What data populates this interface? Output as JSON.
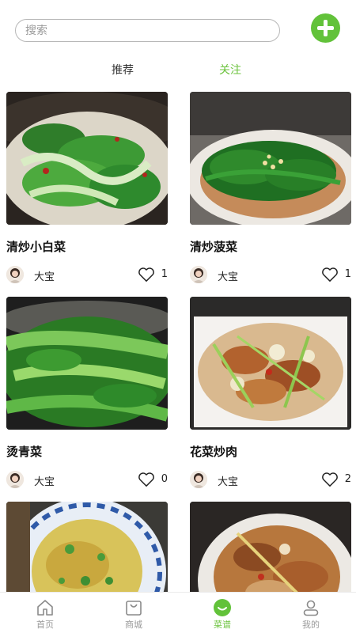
{
  "search": {
    "placeholder": "搜索"
  },
  "tabs": [
    {
      "label": "推荐",
      "active": false
    },
    {
      "label": "关注",
      "active": true
    }
  ],
  "colors": {
    "accent": "#62c23a",
    "tab_active": "#6cc33e"
  },
  "recipes": [
    {
      "title": "清炒小白菜",
      "author": "大宝",
      "likes": "1"
    },
    {
      "title": "清炒菠菜",
      "author": "大宝",
      "likes": "1"
    },
    {
      "title": "烫青菜",
      "author": "大宝",
      "likes": "0"
    },
    {
      "title": "花菜炒肉",
      "author": "大宝",
      "likes": "2"
    }
  ],
  "nav": [
    {
      "label": "首页",
      "icon": "home-icon"
    },
    {
      "label": "商城",
      "icon": "shopping-bag-icon"
    },
    {
      "label": "菜谱",
      "icon": "recipe-icon",
      "active": true
    },
    {
      "label": "我的",
      "icon": "user-icon"
    }
  ]
}
